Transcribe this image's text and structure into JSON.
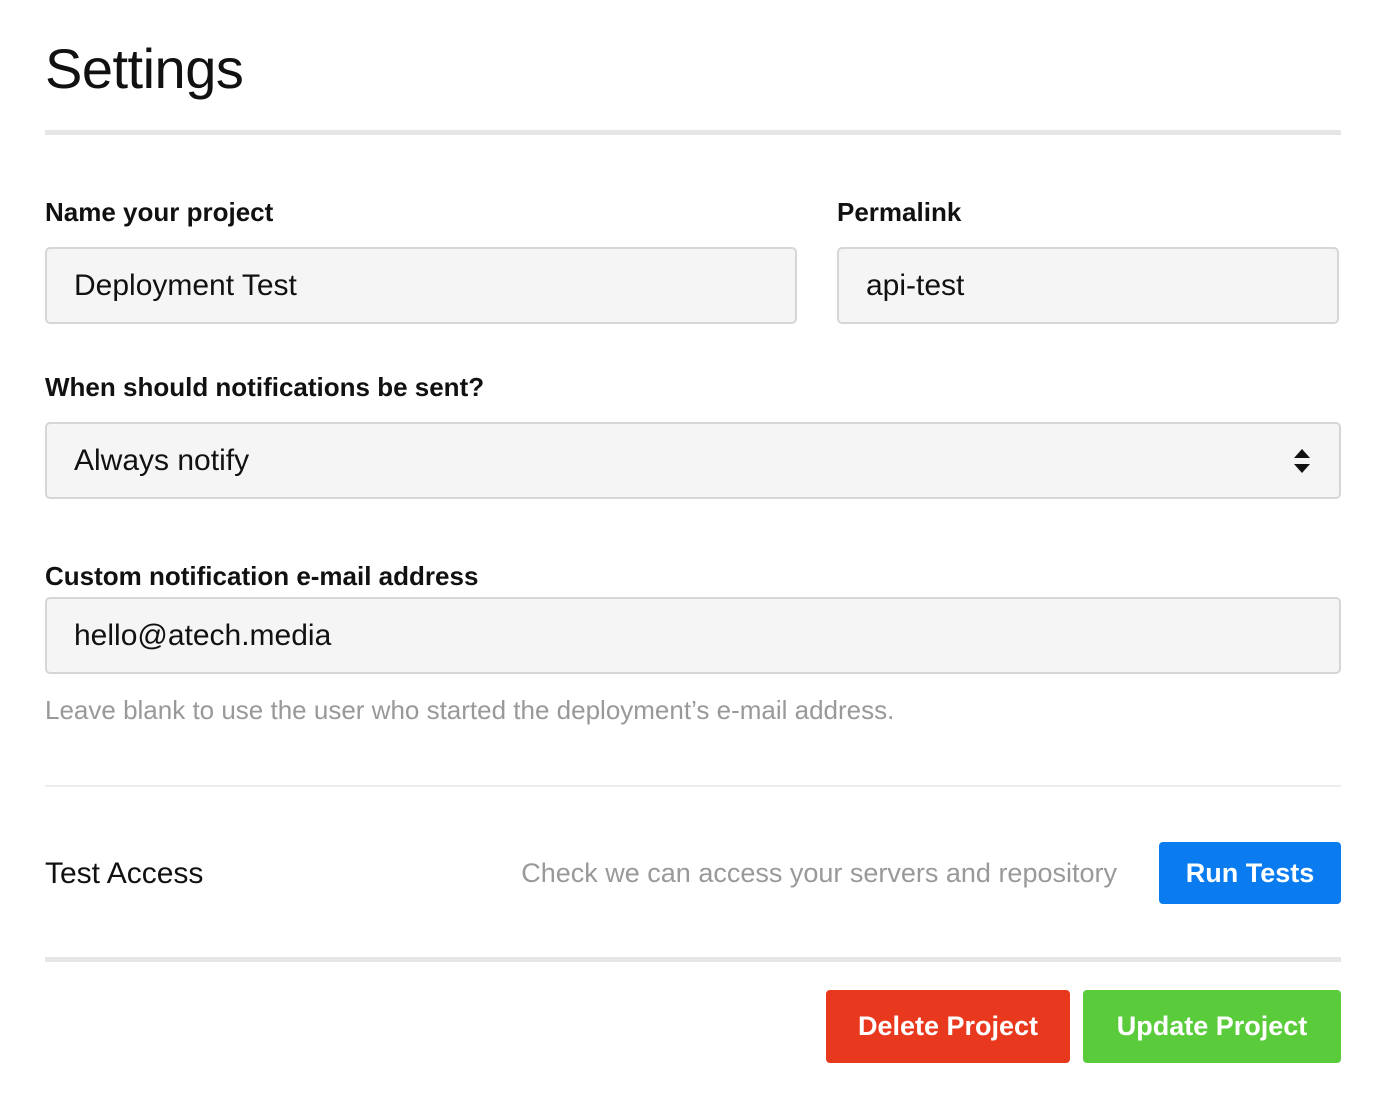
{
  "page": {
    "title": "Settings"
  },
  "form": {
    "project_name": {
      "label": "Name your project",
      "value": "Deployment Test"
    },
    "permalink": {
      "label": "Permalink",
      "value": "api-test"
    },
    "notifications": {
      "label": "When should notifications be sent?",
      "selected": "Always notify"
    },
    "custom_email": {
      "label": "Custom notification e-mail address",
      "value": "hello@atech.media",
      "hint": "Leave blank to use the user who started the deployment’s e-mail address."
    }
  },
  "test_access": {
    "title": "Test Access",
    "description": "Check we can access your servers and repository",
    "button_label": "Run Tests"
  },
  "actions": {
    "delete_label": "Delete Project",
    "update_label": "Update Project"
  },
  "colors": {
    "primary_blue": "#0a7cf0",
    "danger_red": "#e8391f",
    "success_green": "#5acc3c"
  },
  "icons": {
    "select_arrows": "updown-chevrons-icon"
  }
}
